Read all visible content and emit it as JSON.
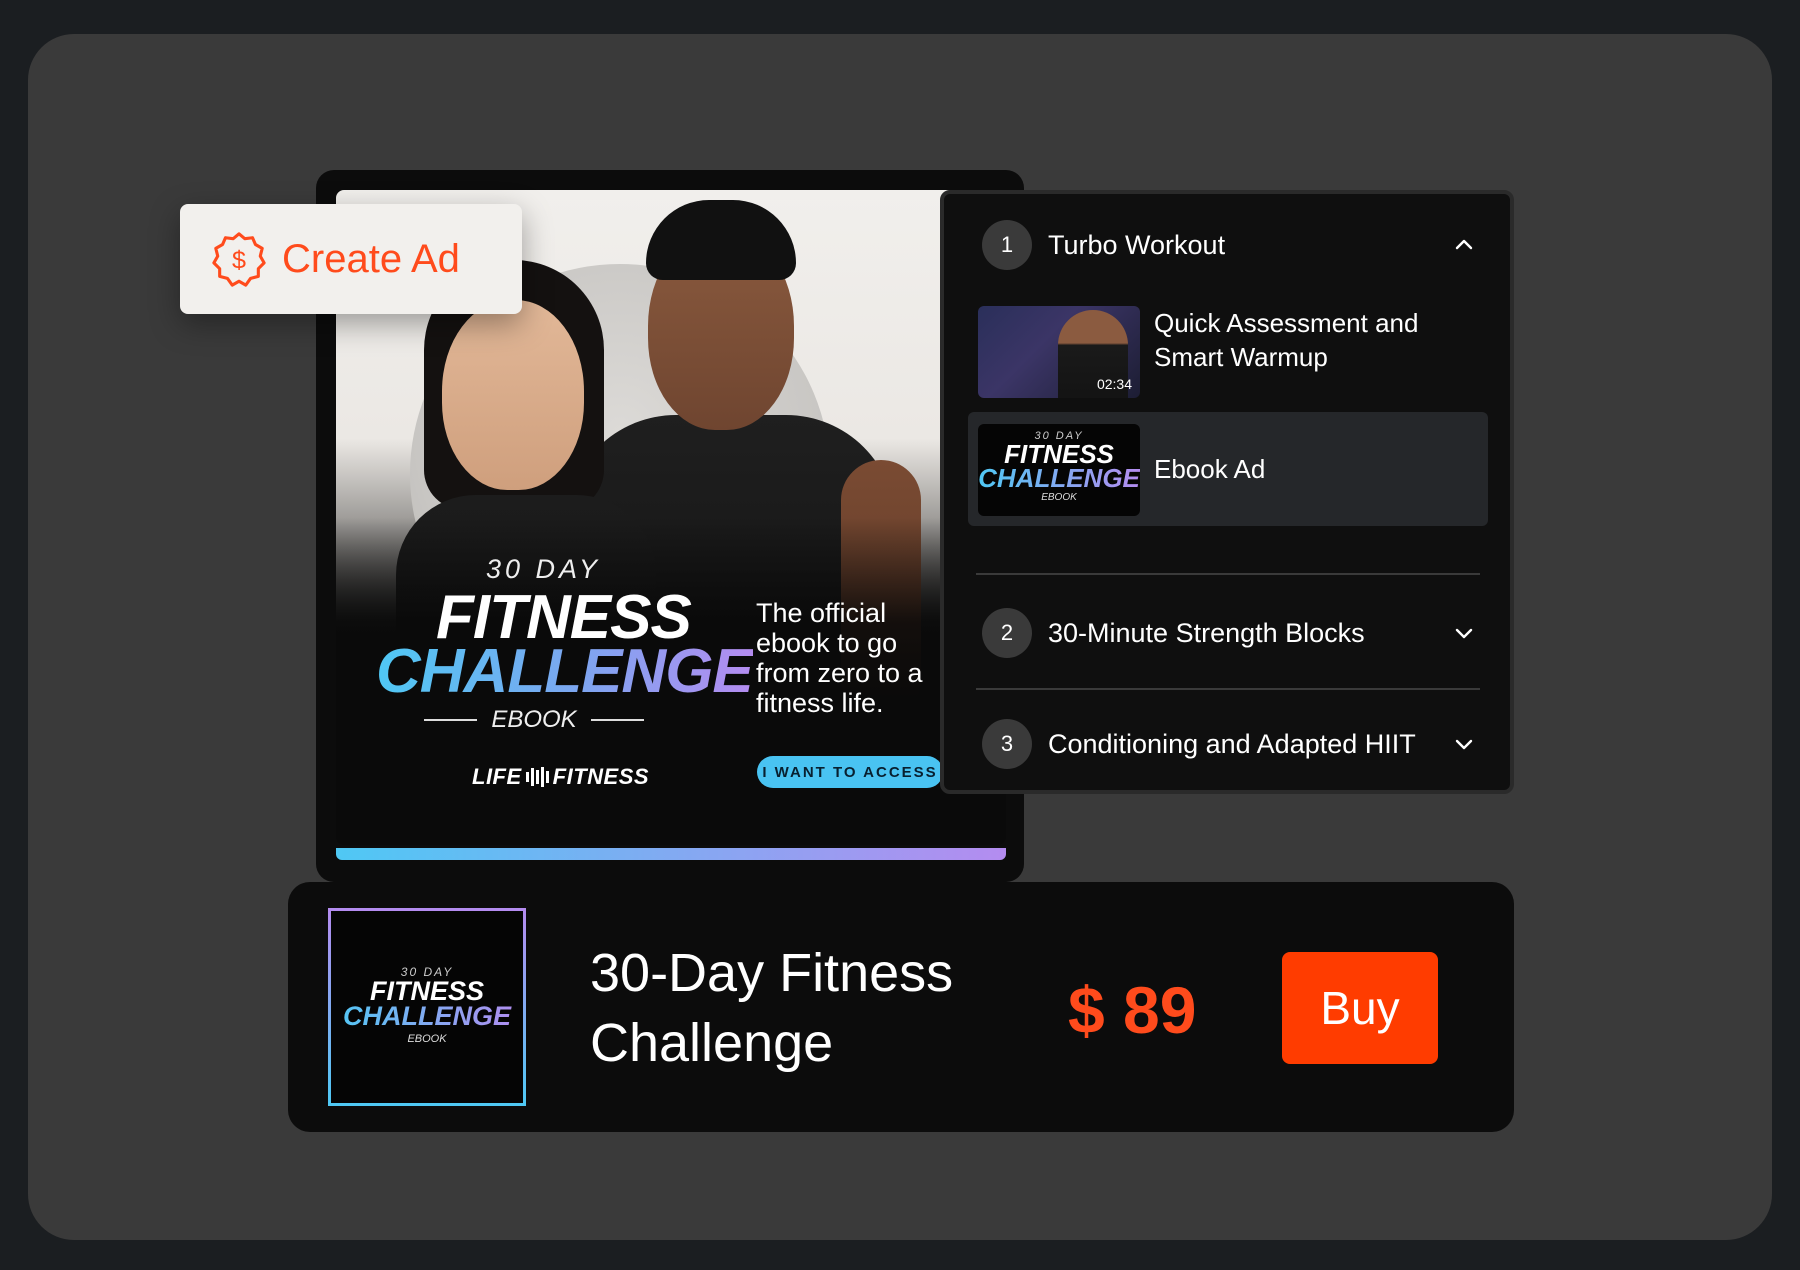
{
  "create_ad": {
    "label": "Create Ad",
    "icon": "dollar-badge-icon",
    "color": "#ff4b1c"
  },
  "ad": {
    "day": "30 DAY",
    "title_line1": "FITNESS",
    "title_line2": "CHALLENGE",
    "subtitle": "EBOOK",
    "tagline": "The official ebook to go from zero to a fitness life.",
    "brand_left": "LIFE",
    "brand_right": "FITNESS",
    "cta": "I WANT TO ACCESS"
  },
  "course": {
    "modules": [
      {
        "number": "1",
        "title": "Turbo Workout",
        "expanded": true,
        "lessons": [
          {
            "title": "Quick Assessment and Smart Warmup",
            "duration": "02:34",
            "type": "video"
          },
          {
            "title": "Ebook Ad",
            "type": "ebook",
            "active": true,
            "thumb": {
              "day": "30 DAY",
              "line1": "FITNESS",
              "line2": "CHALLENGE",
              "line3": "EBOOK"
            }
          }
        ]
      },
      {
        "number": "2",
        "title": "30-Minute Strength Blocks",
        "expanded": false
      },
      {
        "number": "3",
        "title": "Conditioning and Adapted HIIT",
        "expanded": false
      }
    ]
  },
  "product": {
    "cover": {
      "day": "30 DAY",
      "line1": "FITNESS",
      "line2": "CHALLENGE",
      "line3": "EBOOK"
    },
    "name": "30-Day Fitness Challenge",
    "price": "$ 89",
    "buy_label": "Buy",
    "accent": "#ff3c00"
  }
}
